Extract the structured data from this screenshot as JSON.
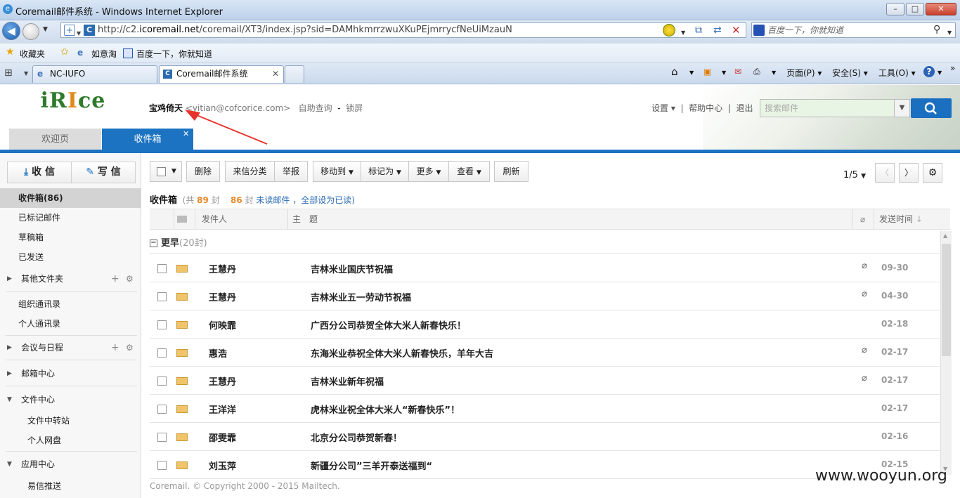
{
  "browser": {
    "title": "Coremail邮件系统 - Windows Internet Explorer",
    "url_prefix": "http://c2.",
    "url_host": "icoremail.net",
    "url_rest": "/coremail/XT3/index.jsp?sid=DAMhkmrrzwuXKuPEjmrrycfNeUiMzauN",
    "search_placeholder": "百度一下，你就知道",
    "favorites_label": "收藏夹",
    "fav_links": [
      "如意淘",
      "百度一下，你就知道"
    ],
    "tabs": [
      "NC-IUFO",
      "Coremail邮件系统"
    ],
    "commands": [
      "页面(P)",
      "安全(S)",
      "工具(O)"
    ]
  },
  "app": {
    "logo_text_a": "iR",
    "logo_text_b": "I",
    "logo_text_c": "ce",
    "user_name": "宝鸡倚天",
    "user_email": "<yitian@cofcorice.com>",
    "self_query": "自助查询",
    "lock": "锁屏",
    "settings": "设置",
    "help": "帮助中心",
    "logout": "退出",
    "search_placeholder": "搜索邮件",
    "tab_welcome": "欢迎页",
    "tab_inbox": "收件箱"
  },
  "sidebar": {
    "receive": "收 信",
    "compose": "写 信",
    "items": [
      {
        "label": "收件箱(86)"
      },
      {
        "label": "已标记邮件"
      },
      {
        "label": "草稿箱"
      },
      {
        "label": "已发送"
      },
      {
        "label": "其他文件夹"
      },
      {
        "label": "组织通讯录"
      },
      {
        "label": "个人通讯录"
      },
      {
        "label": "会议与日程"
      },
      {
        "label": "邮箱中心"
      },
      {
        "label": "文件中心"
      },
      {
        "label": "文件中转站"
      },
      {
        "label": "个人网盘"
      },
      {
        "label": "应用中心"
      },
      {
        "label": "易信推送"
      }
    ]
  },
  "toolbar": {
    "delete": "删除",
    "classify": "来信分类",
    "report": "举报",
    "move": "移动到",
    "mark": "标记为",
    "more": "更多",
    "view": "查看",
    "refresh": "刷新",
    "page": "1/5"
  },
  "folder": {
    "name": "收件箱",
    "total_pre": "(共",
    "total": "89",
    "total_post": "封",
    "unread": "86",
    "unread_post": "封",
    "unread_link": "未读邮件",
    "mark_all": "，全部设为已读",
    "close": ")"
  },
  "columns": {
    "from": "发件人",
    "subject": "主　题",
    "date": "发送时间"
  },
  "group": {
    "label": "更早",
    "count": "(20封)"
  },
  "messages": [
    {
      "from": "王慧丹",
      "subject": "吉林米业国庆节祝福",
      "date": "09-30",
      "attach": true
    },
    {
      "from": "王慧丹",
      "subject": "吉林米业五一劳动节祝福",
      "date": "04-30",
      "attach": true
    },
    {
      "from": "何映霏",
      "subject": "广西分公司恭贺全体大米人新春快乐！",
      "date": "02-18",
      "attach": false
    },
    {
      "from": "惠浩",
      "subject": "东海米业恭祝全体大米人新春快乐，羊年大吉",
      "date": "02-17",
      "attach": true
    },
    {
      "from": "王慧丹",
      "subject": "吉林米业新年祝福",
      "date": "02-17",
      "attach": true
    },
    {
      "from": "王洋洋",
      "subject": "虎林米业祝全体大米人“新春快乐”！",
      "date": "02-17",
      "attach": false
    },
    {
      "from": "邵雯霏",
      "subject": "北京分公司恭贺新春！",
      "date": "02-16",
      "attach": false
    },
    {
      "from": "刘玉萍",
      "subject": "新疆分公司”三羊开泰送福到“",
      "date": "02-15",
      "attach": false
    }
  ],
  "footer": "Coremail. © Copyright 2000 - 2015 Mailtech.",
  "watermark": "www.wooyun.org",
  "colors": {
    "accent": "#1c73c2",
    "arrow": "#e8332c"
  }
}
